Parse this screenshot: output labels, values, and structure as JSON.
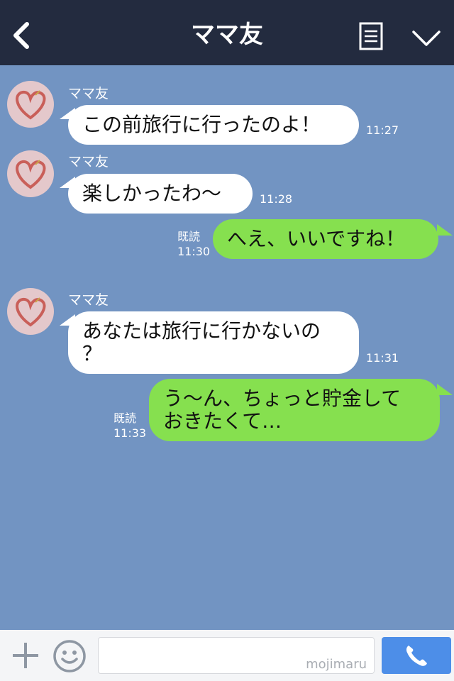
{
  "header": {
    "title": "ママ友"
  },
  "messages": [
    {
      "sender": "ママ友",
      "text": "この前旅行に行ったのよ！",
      "time": "11:27"
    },
    {
      "sender": "ママ友",
      "text": "楽しかったわ〜",
      "time": "11:28"
    },
    {
      "text": "へえ、いいですね！",
      "read": "既読",
      "time": "11:30"
    },
    {
      "sender": "ママ友",
      "line1": "あなたは旅行に行かないの",
      "line2": "？",
      "time": "11:31"
    },
    {
      "line1": "う〜ん、ちょっと貯金して",
      "line2": "おきたくて…",
      "read": "既読",
      "time": "11:33"
    }
  ],
  "input": {
    "watermark": "mojimaru"
  },
  "icons": {
    "back": "back-arrow-icon",
    "menu": "menu-icon",
    "collapse": "chevron-down-icon",
    "add": "plus-icon",
    "emoji": "smile-icon",
    "send": "phone-icon"
  },
  "colors": {
    "header": "#232b3f",
    "background": "#7294c2",
    "incoming": "#ffffff",
    "outgoing": "#86e04f",
    "send": "#4d8ee8"
  }
}
